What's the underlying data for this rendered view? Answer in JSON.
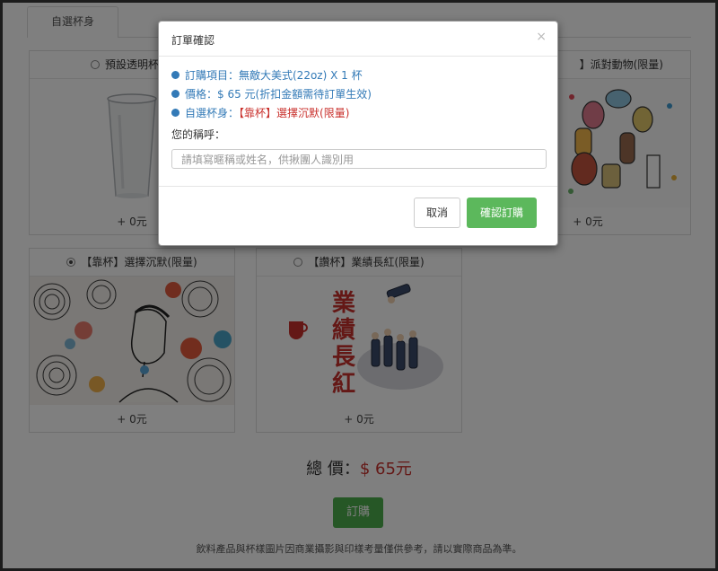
{
  "tabs": {
    "active": "自選杯身"
  },
  "cards": [
    {
      "label": "預設透明杯/空",
      "price": "+ 0元",
      "selected": false
    },
    {
      "label": "】派對動物(限量)",
      "price": "+ 0元",
      "selected": false
    },
    {
      "label": "【靠杯】選擇沉默(限量)",
      "price": "+ 0元",
      "selected": true
    },
    {
      "label": "【讚杯】業績長紅(限量)",
      "price": "+ 0元",
      "selected": false,
      "poster_text": [
        "業",
        "績",
        "長",
        "紅"
      ]
    }
  ],
  "total": {
    "label": "總 價：",
    "amount": "$ 65元"
  },
  "order_button": "訂購",
  "note": "飲料產品與杯樣圖片因商業攝影與印樣考量僅供參考，請以實際商品為準。",
  "modal": {
    "title": "訂單確認",
    "close": "×",
    "item_line": "訂購項目：無敵大美式(22oz) X 1 杯",
    "price_line": "價格：$ 65 元(折扣金額需待訂單生效)",
    "cup_prefix": "自選杯身：",
    "cup_value": "【靠杯】選擇沉默(限量)",
    "nickname_label": "您的稱呼：",
    "nickname_placeholder": "請填寫暱稱或姓名，供揪團人識別用",
    "cancel_button": "取消",
    "confirm_button": "確認訂購"
  },
  "colors": {
    "confirm": "#5cb85c",
    "info": "#337ab7",
    "accent_red": "#c9302c"
  }
}
